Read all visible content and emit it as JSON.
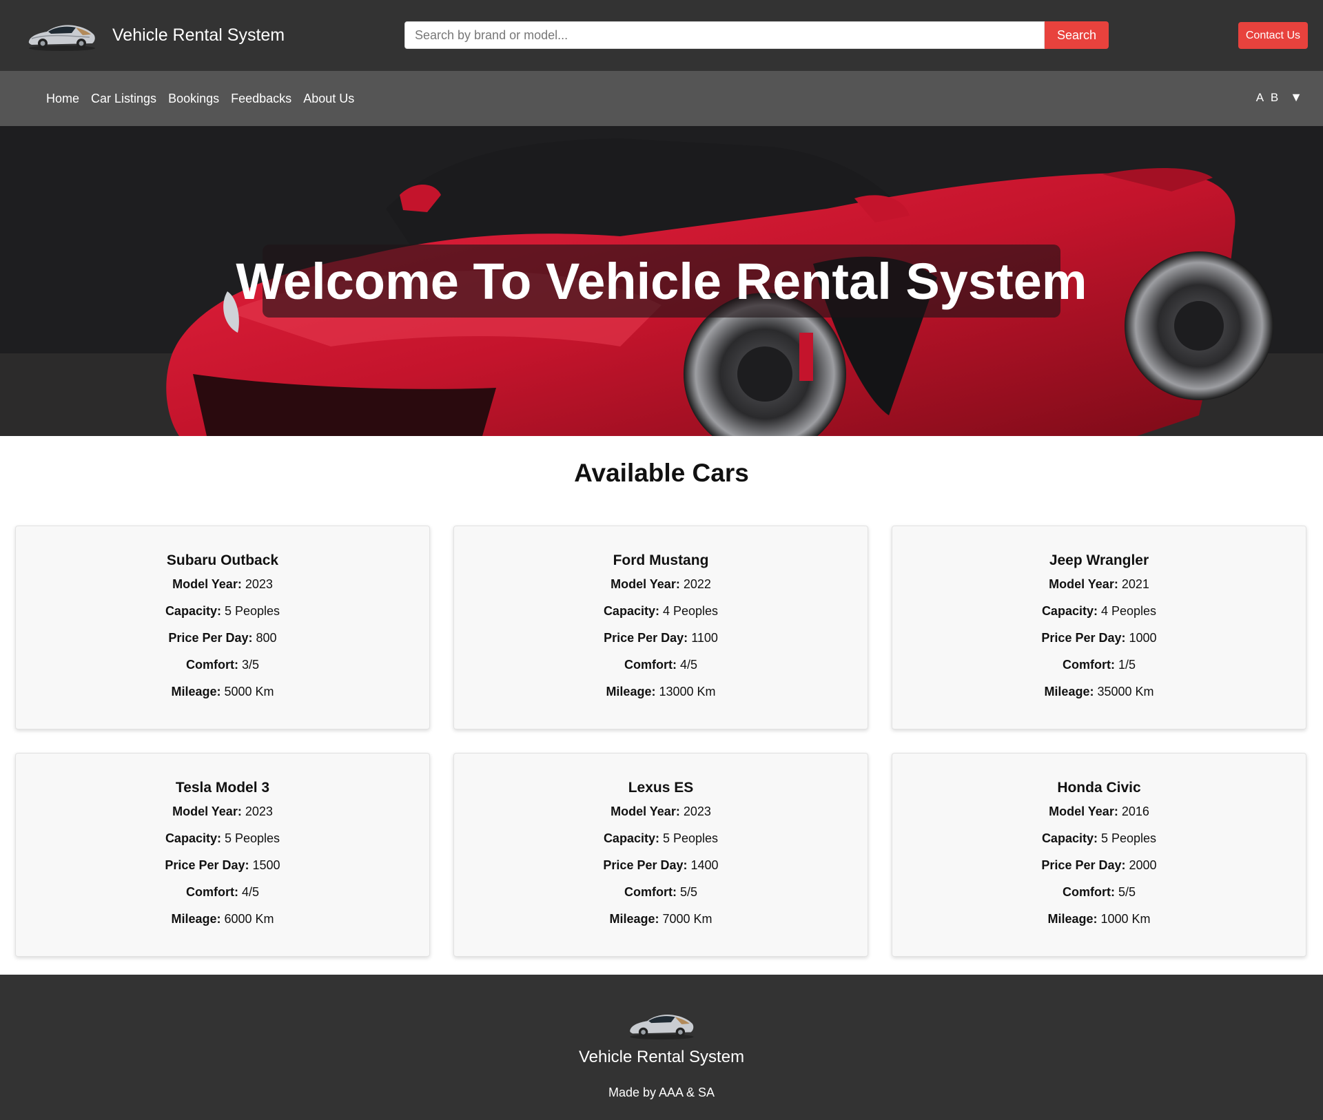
{
  "header": {
    "brand_title": "Vehicle Rental System",
    "logo_icon": "sports-car-icon",
    "search_placeholder": "Search by brand or model...",
    "search_button": "Search",
    "contact_button": "Contact Us"
  },
  "nav": {
    "links": [
      "Home",
      "Car Listings",
      "Bookings",
      "Feedbacks",
      "About Us"
    ],
    "user_initials": "A B",
    "user_caret": "▼"
  },
  "hero": {
    "title": "Welcome To Vehicle Rental System"
  },
  "cars_section": {
    "title": "Available Cars",
    "labels": {
      "model_year": "Model Year:",
      "capacity": "Capacity:",
      "price_per_day": "Price Per Day:",
      "comfort": "Comfort:",
      "mileage": "Mileage:"
    },
    "cars": [
      {
        "name": "Subaru Outback",
        "model_year": "2023",
        "capacity": "5 Peoples",
        "price_per_day": "800",
        "comfort": "3/5",
        "mileage": "5000 Km"
      },
      {
        "name": "Ford Mustang",
        "model_year": "2022",
        "capacity": "4 Peoples",
        "price_per_day": "1100",
        "comfort": "4/5",
        "mileage": "13000 Km"
      },
      {
        "name": "Jeep Wrangler",
        "model_year": "2021",
        "capacity": "4 Peoples",
        "price_per_day": "1000",
        "comfort": "1/5",
        "mileage": "35000 Km"
      },
      {
        "name": "Tesla Model 3",
        "model_year": "2023",
        "capacity": "5 Peoples",
        "price_per_day": "1500",
        "comfort": "4/5",
        "mileage": "6000 Km"
      },
      {
        "name": "Lexus ES",
        "model_year": "2023",
        "capacity": "5 Peoples",
        "price_per_day": "1400",
        "comfort": "5/5",
        "mileage": "7000 Km"
      },
      {
        "name": "Honda Civic",
        "model_year": "2016",
        "capacity": "5 Peoples",
        "price_per_day": "2000",
        "comfort": "5/5",
        "mileage": "1000 Km"
      }
    ]
  },
  "footer": {
    "title": "Vehicle Rental System",
    "credit": "Made by AAA & SA"
  },
  "colors": {
    "header_bg": "#333333",
    "nav_bg": "#555555",
    "accent": "#e8423d",
    "card_bg": "#f8f8f8"
  }
}
